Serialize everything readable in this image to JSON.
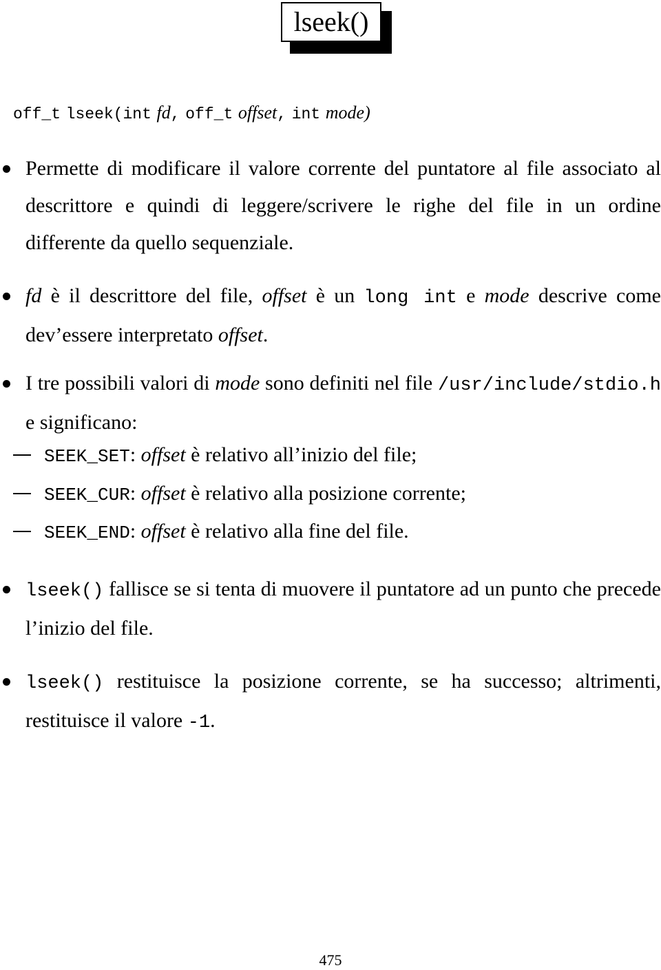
{
  "title": "lseek()",
  "signature": {
    "return_type": "off_t",
    "function_name": "lseek(",
    "param1_type": "int",
    "param1_name": "fd",
    "sep1": ",",
    "param2_type": "off_t",
    "param2_name": "offset",
    "sep2": ",",
    "param3_type": "int",
    "param3_name": "mode",
    "close": ")"
  },
  "bullets": [
    {
      "text": "Permette di modificare il valore corrente del puntatore al file associato al descrittore e quindi di leggere/scrivere le righe del file in un ordine differente da quello sequenziale."
    },
    {
      "fd": "fd",
      "t1": " è il descrittore del file, ",
      "offset": "offset",
      "t2": " è un ",
      "code": "long int",
      "t3": " e ",
      "mode": "mode",
      "t4": " descrive come dev’essere interpretato ",
      "offset2": "offset",
      "t5": "."
    },
    {
      "t1": "I tre possibili valori di ",
      "mode": "mode",
      "t2": " sono definiti nel file ",
      "path": "/usr/include/stdio.h",
      "t3": " e significano:",
      "sub_items": [
        {
          "const": "SEEK_SET",
          "colon": ": ",
          "offset": "offset",
          "desc": " è relativo all’inizio del file;"
        },
        {
          "const": "SEEK_CUR",
          "colon": ": ",
          "offset": "offset",
          "desc": " è relativo alla posizione corrente;"
        },
        {
          "const": "SEEK_END",
          "colon": ": ",
          "offset": "offset",
          "desc": " è relativo alla fine del file."
        }
      ]
    },
    {
      "code": "lseek()",
      "text": " fallisce se si tenta di muovere il puntatore ad un punto che precede l’inizio del file."
    },
    {
      "code": "lseek()",
      "text": " restituisce la posizione corrente, se ha successo; altrimenti, restituisce il valore ",
      "value": "-1",
      "end": "."
    }
  ],
  "page_number": "475"
}
